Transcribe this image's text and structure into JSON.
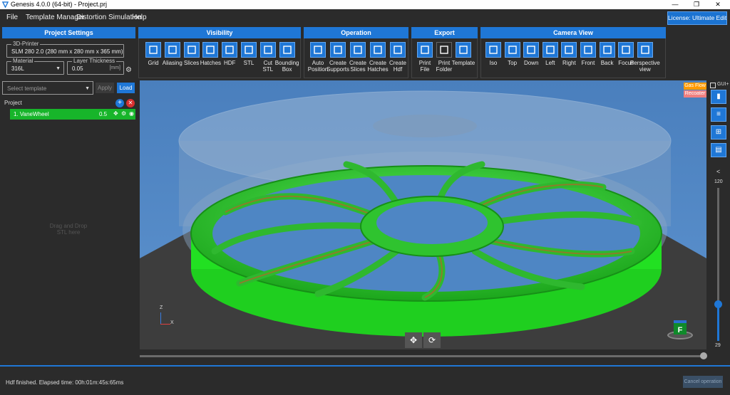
{
  "window": {
    "title": "Genesis 4.0.0 (64-bit) - Project.prj",
    "minimize": "—",
    "maximize": "❐",
    "close": "✕"
  },
  "menu": {
    "items": [
      "File",
      "Template Manager",
      "Distortion Simulation",
      "Help"
    ],
    "license": "License: Ultimate Edition"
  },
  "panels": {
    "project_settings": {
      "title": "Project Settings",
      "printer_legend": "3D-Printer",
      "printer_value": "SLM 280 2.0  (280 mm x 280 mm x 365 mm)",
      "material_legend": "Material",
      "material_value": "316L",
      "layer_legend": "Layer Thickness",
      "layer_value": "0.05",
      "layer_unit": "[mm]"
    },
    "visibility": {
      "title": "Visibility",
      "tools": [
        {
          "label": "Grid",
          "icon": "grid-icon"
        },
        {
          "label": "Aliasing",
          "icon": "monitor-icon"
        },
        {
          "label": "Slices",
          "icon": "slices-icon"
        },
        {
          "label": "Hatches",
          "icon": "hatches-icon"
        },
        {
          "label": "HDF",
          "icon": "hdf-icon"
        },
        {
          "label": "STL",
          "icon": "cube-icon"
        },
        {
          "label": "Cut\nSTL",
          "icon": "cut-cube-icon"
        },
        {
          "label": "Bounding\nBox",
          "icon": "bounding-box-icon"
        }
      ]
    },
    "operation": {
      "title": "Operation",
      "tools": [
        {
          "label": "Auto\nPosition",
          "icon": "auto-position-icon"
        },
        {
          "label": "Create\nSupports",
          "icon": "supports-icon"
        },
        {
          "label": "Create\nSlices",
          "icon": "create-slices-icon"
        },
        {
          "label": "Create\nHatches",
          "icon": "create-hatches-icon"
        },
        {
          "label": "Create\nHdf",
          "icon": "create-hdf-icon"
        }
      ]
    },
    "export": {
      "title": "Export",
      "tools": [
        {
          "label": "Print\nFile",
          "icon": "print-file-icon"
        },
        {
          "label": "Print\nFolder",
          "icon": "print-folder-icon"
        },
        {
          "label": "Template",
          "icon": "template-icon"
        }
      ]
    },
    "camera": {
      "title": "Camera View",
      "tools": [
        {
          "label": "Iso",
          "icon": "iso-icon"
        },
        {
          "label": "Top",
          "icon": "top-view-icon"
        },
        {
          "label": "Down",
          "icon": "down-view-icon"
        },
        {
          "label": "Left",
          "icon": "left-view-icon"
        },
        {
          "label": "Right",
          "icon": "right-view-icon"
        },
        {
          "label": "Front",
          "icon": "front-view-icon"
        },
        {
          "label": "Back",
          "icon": "back-view-icon"
        },
        {
          "label": "Focus",
          "icon": "focus-icon"
        },
        {
          "label": "Perspective\nview",
          "icon": "camera-icon"
        }
      ]
    }
  },
  "template": {
    "placeholder": "Select template",
    "apply": "Apply",
    "load": "Load"
  },
  "project": {
    "label": "Project",
    "items": [
      {
        "name": "1.  VaneWheel",
        "value": "0.5"
      }
    ],
    "drop_hint": "Drag and Drop\nSTL here"
  },
  "viewport": {
    "gas_flow": "Gas Flow",
    "recoater": "Recoater",
    "axis_z": "Z",
    "axis_x": "X",
    "cube_face": "F",
    "gui_toggle": "GUI+"
  },
  "layer_slider": {
    "max": "120",
    "current": "29",
    "collapse": "<"
  },
  "status": {
    "message": "Hdf finished. Elapsed time: 00h:01m:45s:65ms",
    "cancel": "Cancel operation"
  },
  "colors": {
    "accent": "#1f77d6",
    "part_green": "#2ee82e",
    "selected_row": "#17b52a",
    "gas_flow": "#ff9a00",
    "recoater": "#f08080"
  }
}
